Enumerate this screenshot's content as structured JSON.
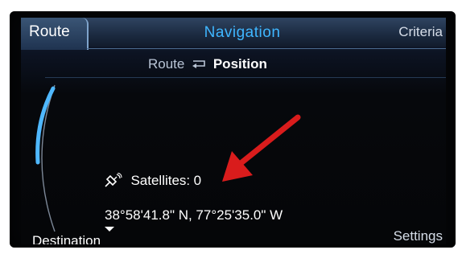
{
  "header": {
    "tab_route": "Route",
    "title": "Navigation",
    "criteria": "Criteria"
  },
  "subtitle": {
    "route": "Route",
    "arrow_icon": "return-arrow-icon",
    "position": "Position"
  },
  "satellites": {
    "icon": "satellite-icon",
    "label": "Satellites:",
    "value": "0"
  },
  "coordinates": "38°58'41.8\" N, 77°25'35.0\" W",
  "footer": {
    "destination": "Destination",
    "settings": "Settings"
  },
  "colors": {
    "title_blue": "#3fb6ff",
    "scroll_arc": "#4fb8ff",
    "annotation_arrow": "#d91c1c"
  }
}
